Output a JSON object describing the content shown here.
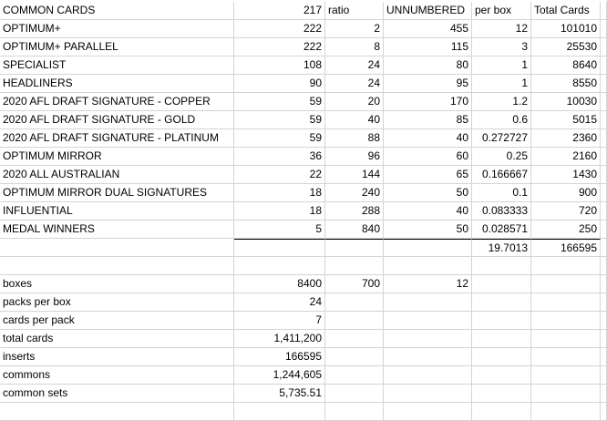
{
  "header": {
    "a": "COMMON CARDS",
    "b": "217",
    "c": "ratio",
    "d": "UNNUMBERED",
    "e": "per box",
    "f": "Total Cards"
  },
  "insert_rows": [
    {
      "name": "OPTIMUM+",
      "b": "222",
      "c": "2",
      "d": "455",
      "e": "12",
      "f": "101010"
    },
    {
      "name": "OPTIMUM+ PARALLEL",
      "b": "222",
      "c": "8",
      "d": "115",
      "e": "3",
      "f": "25530"
    },
    {
      "name": "SPECIALIST",
      "b": "108",
      "c": "24",
      "d": "80",
      "e": "1",
      "f": "8640"
    },
    {
      "name": "HEADLINERS",
      "b": "90",
      "c": "24",
      "d": "95",
      "e": "1",
      "f": "8550"
    },
    {
      "name": "2020 AFL DRAFT SIGNATURE - COPPER",
      "b": "59",
      "c": "20",
      "d": "170",
      "e": "1.2",
      "f": "10030"
    },
    {
      "name": "2020 AFL DRAFT SIGNATURE - GOLD",
      "b": "59",
      "c": "40",
      "d": "85",
      "e": "0.6",
      "f": "5015"
    },
    {
      "name": "2020 AFL DRAFT SIGNATURE - PLATINUM",
      "b": "59",
      "c": "88",
      "d": "40",
      "e": "0.272727",
      "f": "2360"
    },
    {
      "name": "OPTIMUM MIRROR",
      "b": "36",
      "c": "96",
      "d": "60",
      "e": "0.25",
      "f": "2160"
    },
    {
      "name": "2020 ALL AUSTRALIAN",
      "b": "22",
      "c": "144",
      "d": "65",
      "e": "0.166667",
      "f": "1430"
    },
    {
      "name": "OPTIMUM MIRROR DUAL SIGNATURES",
      "b": "18",
      "c": "240",
      "d": "50",
      "e": "0.1",
      "f": "900"
    },
    {
      "name": "INFLUENTIAL",
      "b": "18",
      "c": "288",
      "d": "40",
      "e": "0.083333",
      "f": "720"
    },
    {
      "name": "MEDAL WINNERS",
      "b": "5",
      "c": "840",
      "d": "50",
      "e": "0.028571",
      "f": "250"
    }
  ],
  "totals": {
    "per_box_sum": "19.7013",
    "total_cards_sum": "166595"
  },
  "summary": {
    "boxes_label": "boxes",
    "boxes_b": "8400",
    "boxes_c": "700",
    "boxes_d": "12",
    "packs_label": "packs per box",
    "packs_value": "24",
    "cards_label": "cards per pack",
    "cards_value": "7",
    "total_label": "total cards",
    "total_value": "1,411,200",
    "inserts_label": "inserts",
    "inserts_value": "166595",
    "commons_label": "commons",
    "commons_value": "1,244,605",
    "sets_label": "common sets",
    "sets_value": "5,735.51"
  }
}
